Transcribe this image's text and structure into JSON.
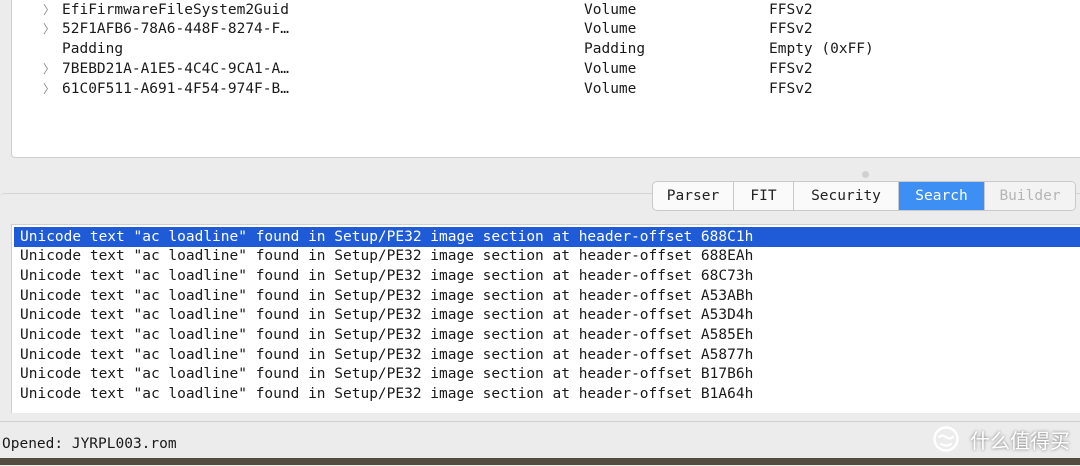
{
  "tree": {
    "rows": [
      {
        "expandable": true,
        "name": "EfiFirmwareFileSystem2Guid",
        "type": "Volume",
        "subtype": "FFSv2"
      },
      {
        "expandable": true,
        "name": "52F1AFB6-78A6-448F-8274-F…",
        "type": "Volume",
        "subtype": "FFSv2"
      },
      {
        "expandable": false,
        "name": "Padding",
        "type": "Padding",
        "subtype": "Empty (0xFF)"
      },
      {
        "expandable": true,
        "name": "7BEBD21A-A1E5-4C4C-9CA1-A…",
        "type": "Volume",
        "subtype": "FFSv2"
      },
      {
        "expandable": true,
        "name": "61C0F511-A691-4F54-974F-B…",
        "type": "Volume",
        "subtype": "FFSv2"
      }
    ]
  },
  "tabs": [
    {
      "label": "Parser",
      "state": "normal"
    },
    {
      "label": "FIT",
      "state": "normal"
    },
    {
      "label": "Security",
      "state": "normal"
    },
    {
      "label": "Search",
      "state": "active"
    },
    {
      "label": "Builder",
      "state": "disabled"
    }
  ],
  "results": [
    "Unicode text \"ac loadline\" found in Setup/PE32 image section at header-offset 688C1h",
    "Unicode text \"ac loadline\" found in Setup/PE32 image section at header-offset 688EAh",
    "Unicode text \"ac loadline\" found in Setup/PE32 image section at header-offset 68C73h",
    "Unicode text \"ac loadline\" found in Setup/PE32 image section at header-offset A53ABh",
    "Unicode text \"ac loadline\" found in Setup/PE32 image section at header-offset A53D4h",
    "Unicode text \"ac loadline\" found in Setup/PE32 image section at header-offset A585Eh",
    "Unicode text \"ac loadline\" found in Setup/PE32 image section at header-offset A5877h",
    "Unicode text \"ac loadline\" found in Setup/PE32 image section at header-offset B17B6h",
    "Unicode text \"ac loadline\" found in Setup/PE32 image section at header-offset B1A64h"
  ],
  "selected_result": 0,
  "status": {
    "text": "Opened: JYRPL003.rom"
  },
  "watermark": {
    "text": "什么值得买",
    "icon": "smzdm-logo-icon"
  },
  "colors": {
    "selection": "#1f5bd6",
    "active_tab": "#3d8ff4"
  }
}
